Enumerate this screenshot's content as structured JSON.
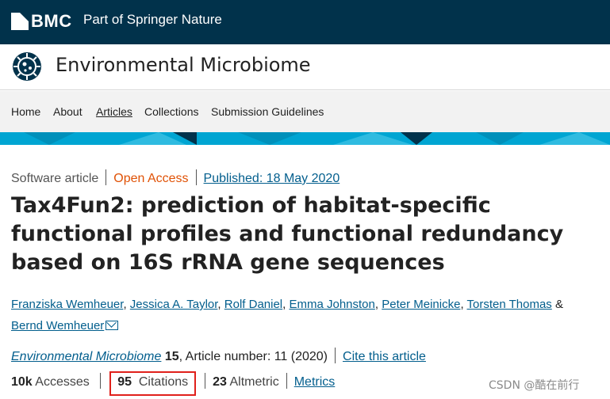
{
  "brand": {
    "name": "BMC",
    "subtitle": "Part of Springer Nature"
  },
  "journal": {
    "title": "Environmental Microbiome"
  },
  "nav": {
    "items": [
      {
        "label": "Home"
      },
      {
        "label": "About"
      },
      {
        "label": "Articles",
        "active": true
      },
      {
        "label": "Collections"
      },
      {
        "label": "Submission Guidelines"
      }
    ]
  },
  "article": {
    "type": "Software article",
    "access": "Open Access",
    "published": "Published: 18 May 2020",
    "title": "Tax4Fun2: prediction of habitat-specific functional profiles and functional redundancy based on 16S rRNA gene sequences",
    "authors": [
      "Franziska Wemheuer",
      "Jessica A. Taylor",
      "Rolf Daniel",
      "Emma Johnston",
      "Peter Meinicke",
      "Torsten Thomas",
      "Bernd Wemheuer"
    ],
    "author_separator": ",",
    "author_last_separator": "&",
    "citation": {
      "journal": "Environmental Microbiome",
      "volume": "15",
      "article_number": ", Article number: 11 (2020)",
      "cite_link": "Cite this article"
    },
    "metrics": {
      "accesses_value": "10k",
      "accesses_label": "Accesses",
      "citations_value": "95",
      "citations_label": "Citations",
      "altmetric_value": "23",
      "altmetric_label": "Altmetric",
      "metrics_link": "Metrics"
    }
  },
  "watermark": "CSDN @酷在前行",
  "colors": {
    "brand_bar": "#01324b",
    "band": "#00a5d2",
    "link": "#025e8d",
    "open_access": "#e05206",
    "highlight_box": "#e0201b"
  }
}
